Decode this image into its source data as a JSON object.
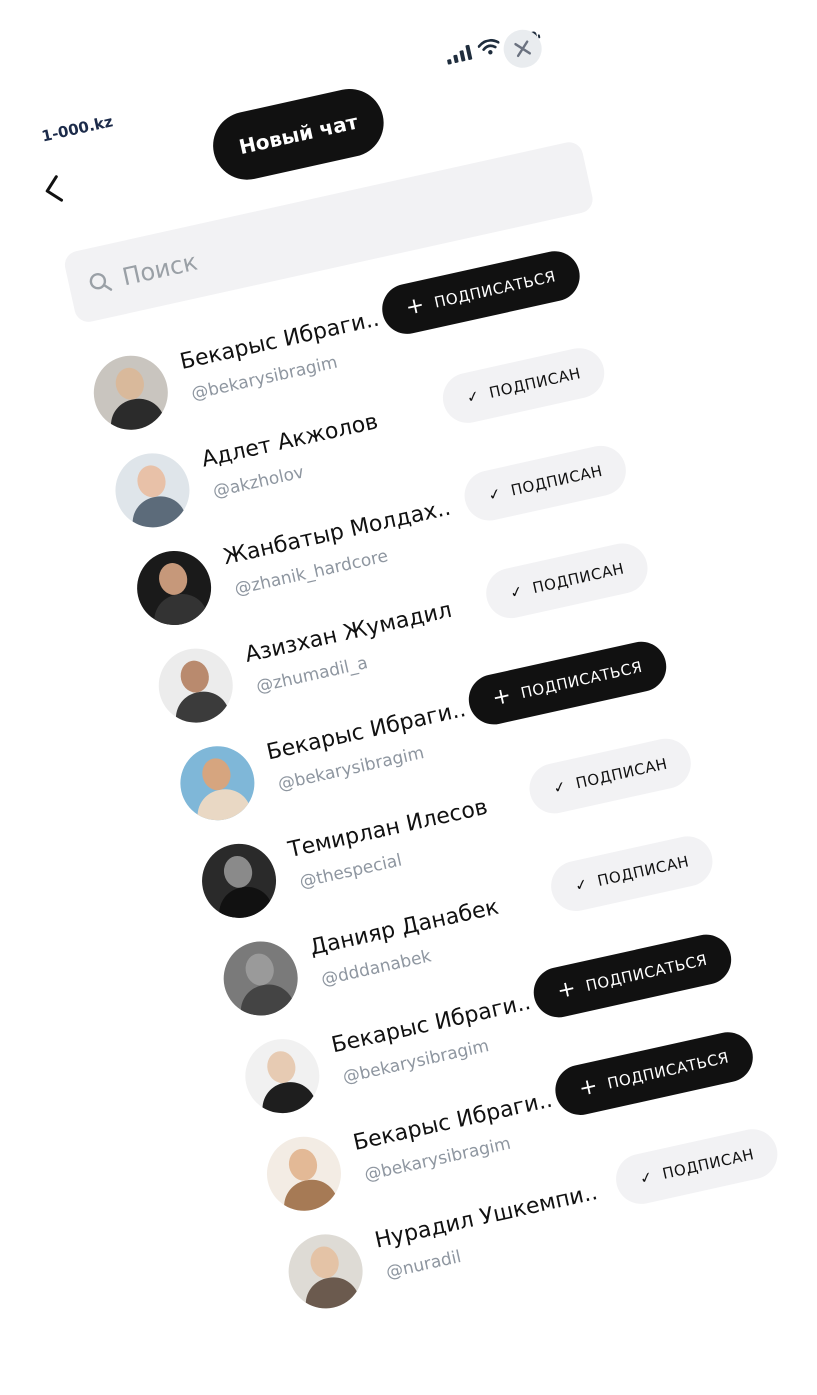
{
  "status": {
    "icons": [
      "signal-icon",
      "wifi-icon",
      "battery-icon"
    ]
  },
  "brand": {
    "text": "1-000.kz"
  },
  "header": {
    "title": "Новый чат"
  },
  "search": {
    "placeholder": "Поиск"
  },
  "labels": {
    "follow": "ПОДПИСАТЬСЯ",
    "followed": "ПОДПИСАН"
  },
  "users": [
    {
      "name": "Бекарыс Ибраги..",
      "handle": "@bekarysibragim",
      "state": "follow"
    },
    {
      "name": "Адлет Акжолов",
      "handle": "@akzholov",
      "state": "followed"
    },
    {
      "name": "Жанбатыр Молдах..",
      "handle": "@zhanik_hardcore",
      "state": "followed"
    },
    {
      "name": "Азизхан Жумадил",
      "handle": "@zhumadil_a",
      "state": "followed"
    },
    {
      "name": "Бекарыс Ибраги..",
      "handle": "@bekarysibragim",
      "state": "follow"
    },
    {
      "name": "Темирлан Илесов",
      "handle": "@thespecial",
      "state": "followed"
    },
    {
      "name": "Данияр Данабек",
      "handle": "@dddanabek",
      "state": "followed"
    },
    {
      "name": "Бекарыс Ибраги..",
      "handle": "@bekarysibragim",
      "state": "follow"
    },
    {
      "name": "Бекарыс Ибраги..",
      "handle": "@bekarysibragim",
      "state": "follow"
    },
    {
      "name": "Нурадил Ушкемпи..",
      "handle": "@nuradil",
      "state": "followed"
    }
  ]
}
